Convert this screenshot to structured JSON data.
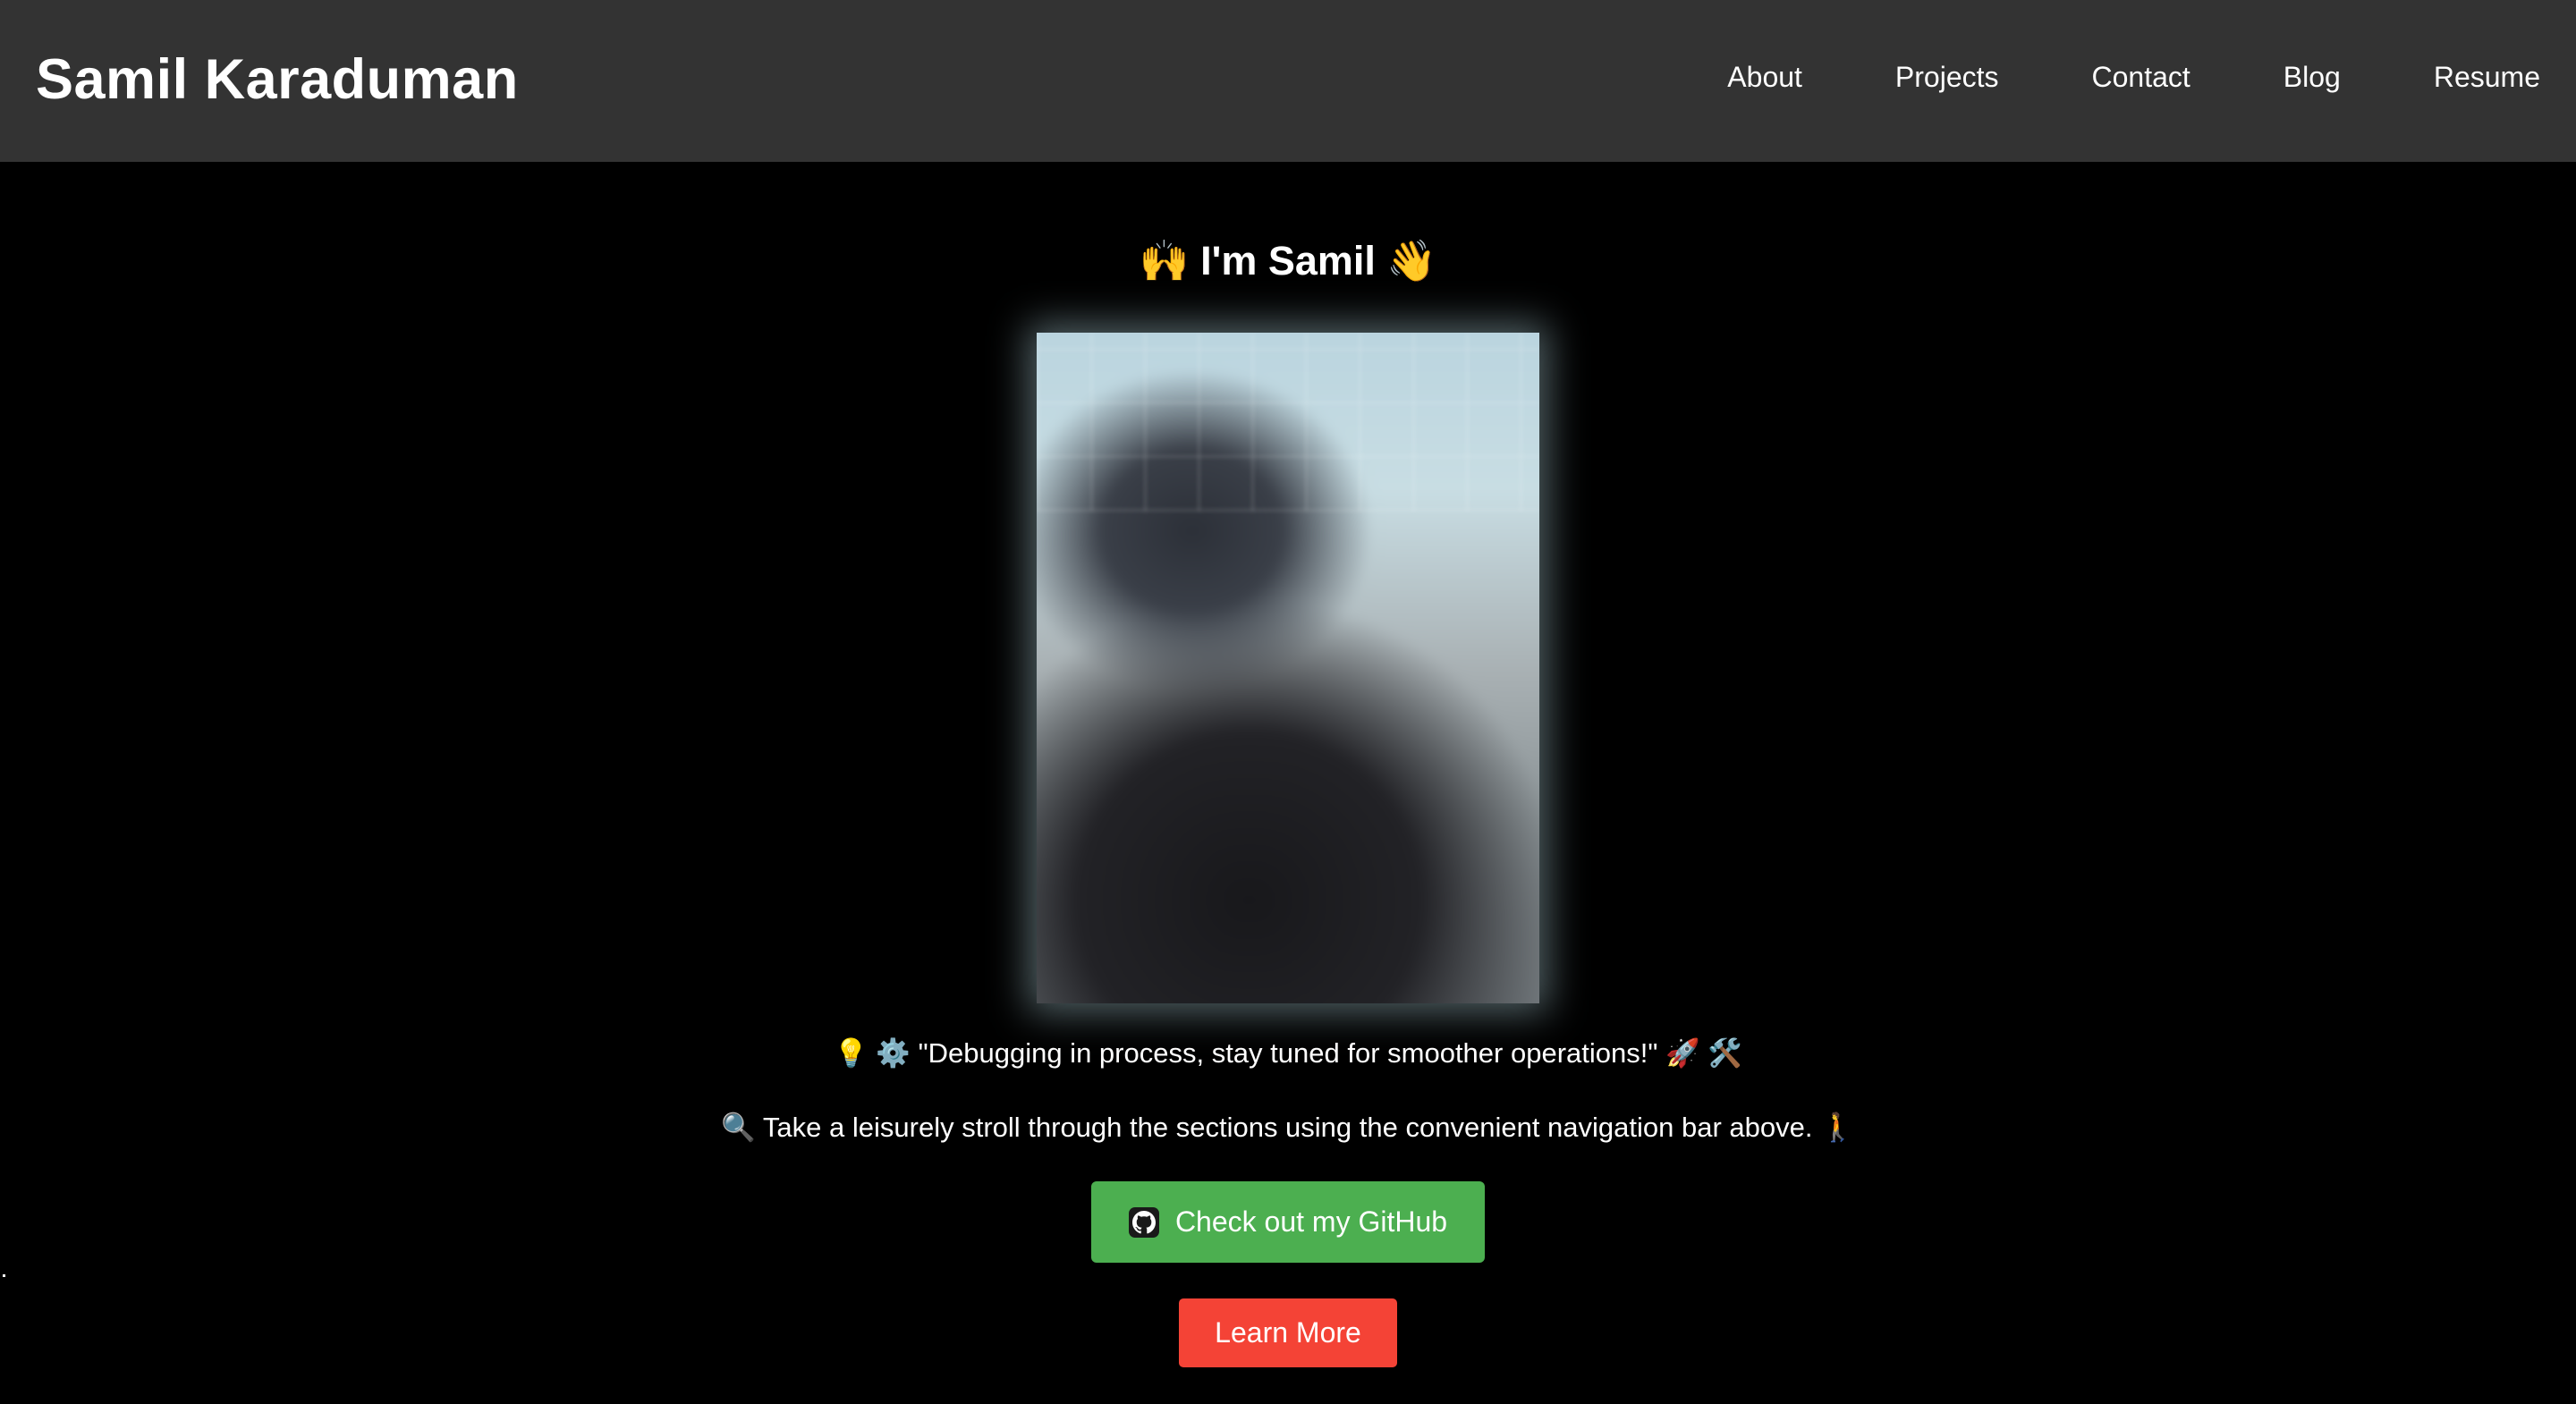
{
  "header": {
    "brand": "Samil Karaduman",
    "nav": [
      {
        "label": "About"
      },
      {
        "label": "Projects"
      },
      {
        "label": "Contact"
      },
      {
        "label": "Blog"
      },
      {
        "label": "Resume"
      }
    ]
  },
  "hero": {
    "title": "🙌 I'm Samil 👋",
    "photo_alt": "profile-photo",
    "tagline": "💡 ⚙️ \"Debugging in process, stay tuned for smoother operations!\" 🚀 🛠️",
    "instruction": "🔍 Take a leisurely stroll through the sections using the convenient navigation bar above. 🚶",
    "github_button": {
      "label": "Check out my GitHub",
      "icon": "github-icon",
      "color": "#4caf50"
    },
    "learn_button": {
      "label": "Learn More",
      "color": "#f44336"
    }
  },
  "colors": {
    "background": "#000000",
    "navbar": "#333333",
    "text": "#ffffff"
  }
}
